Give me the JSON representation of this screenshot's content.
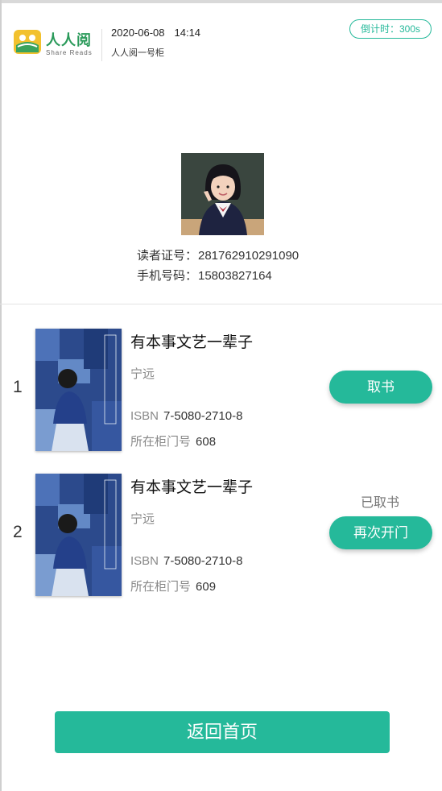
{
  "header": {
    "brand_name": "人人阅",
    "brand_sub": "Share Reads",
    "date": "2020-06-08",
    "time": "14:14",
    "cabinet_name": "人人阅一号柜",
    "countdown": "倒计时：300s"
  },
  "reader": {
    "card_label": "读者证号：",
    "card_number": "281762910291090",
    "phone_label": "手机号码：",
    "phone_number": "15803827164"
  },
  "books": [
    {
      "index": "1",
      "cover_text": "有本事文艺一辈子",
      "title": "有本事文艺一辈子",
      "author": "宁远",
      "isbn_label": "ISBN",
      "isbn": "7-5080-2710-8",
      "door_label": "所在柜门号",
      "door": "608",
      "status": "",
      "action": "取书"
    },
    {
      "index": "2",
      "cover_text": "有本事文艺一辈子",
      "title": "有本事文艺一辈子",
      "author": "宁远",
      "isbn_label": "ISBN",
      "isbn": "7-5080-2710-8",
      "door_label": "所在柜门号",
      "door": "609",
      "status": "已取书",
      "action": "再次开门"
    }
  ],
  "footer": {
    "home_label": "返回首页"
  },
  "colors": {
    "accent": "#25b99a",
    "brand": "#2a9a5a"
  }
}
